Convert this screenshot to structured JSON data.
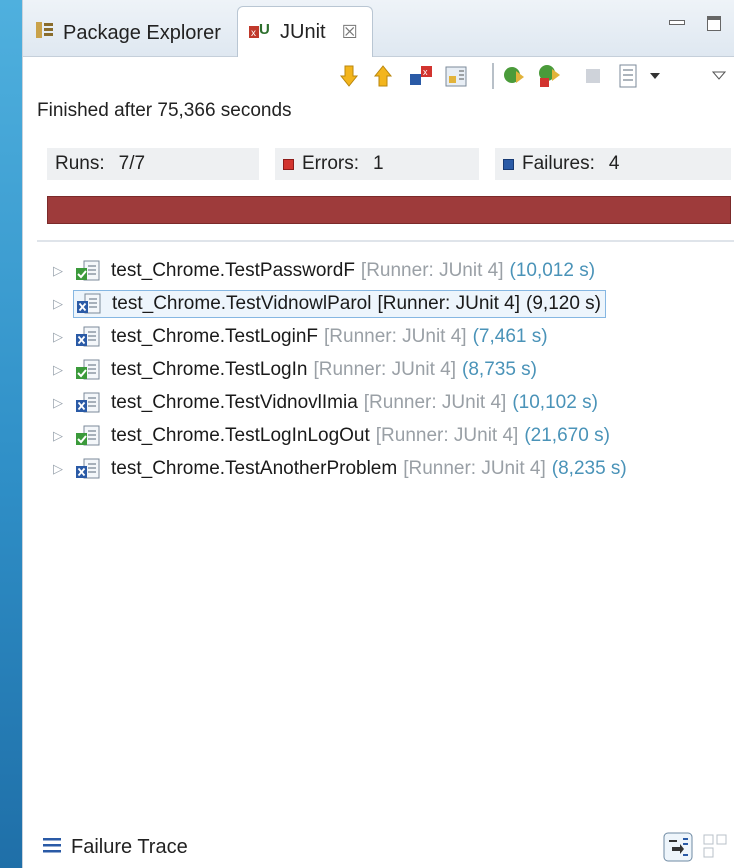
{
  "tabs": {
    "package_explorer": "Package Explorer",
    "junit": "JUnit",
    "close_glyph": "☒"
  },
  "toolbar": {
    "icons": [
      "next-failure-icon",
      "previous-failure-icon",
      "show-failures-only-icon",
      "scroll-lock-icon",
      "rerun-test-icon",
      "rerun-failed-first-icon",
      "stop-icon",
      "test-run-history-icon",
      "dropdown-arrow-icon",
      "view-menu-icon"
    ]
  },
  "status": "Finished after 75,366 seconds",
  "counters": {
    "runs_label": "Runs:",
    "runs_value": "7/7",
    "errors_label": "Errors:",
    "errors_value": "1",
    "failures_label": "Failures:",
    "failures_value": "4"
  },
  "progress": {
    "fraction": 1.0,
    "color": "#9e3b3b"
  },
  "tests": [
    {
      "name": "test_Chrome.TestPasswordF",
      "runner": "[Runner: JUnit 4]",
      "time": "(10,012 s)",
      "status": "ok",
      "selected": false
    },
    {
      "name": "test_Chrome.TestVidnowlParol",
      "runner": "[Runner: JUnit 4]",
      "time": "(9,120 s)",
      "status": "fail",
      "selected": true
    },
    {
      "name": "test_Chrome.TestLoginF",
      "runner": "[Runner: JUnit 4]",
      "time": "(7,461 s)",
      "status": "fail",
      "selected": false
    },
    {
      "name": "test_Chrome.TestLogIn",
      "runner": "[Runner: JUnit 4]",
      "time": "(8,735 s)",
      "status": "ok",
      "selected": false
    },
    {
      "name": "test_Chrome.TestVidnovlImia",
      "runner": "[Runner: JUnit 4]",
      "time": "(10,102 s)",
      "status": "fail",
      "selected": false
    },
    {
      "name": "test_Chrome.TestLogInLogOut",
      "runner": "[Runner: JUnit 4]",
      "time": "(21,670 s)",
      "status": "ok",
      "selected": false
    },
    {
      "name": "test_Chrome.TestAnotherProblem",
      "runner": "[Runner: JUnit 4]",
      "time": "(8,235 s)",
      "status": "fail",
      "selected": false
    }
  ],
  "trace": {
    "label": "Failure Trace"
  },
  "colors": {
    "ok": "#3b9a3b",
    "fail": "#2a5aa6",
    "error": "#d2342f",
    "time": "#4a93b8"
  }
}
